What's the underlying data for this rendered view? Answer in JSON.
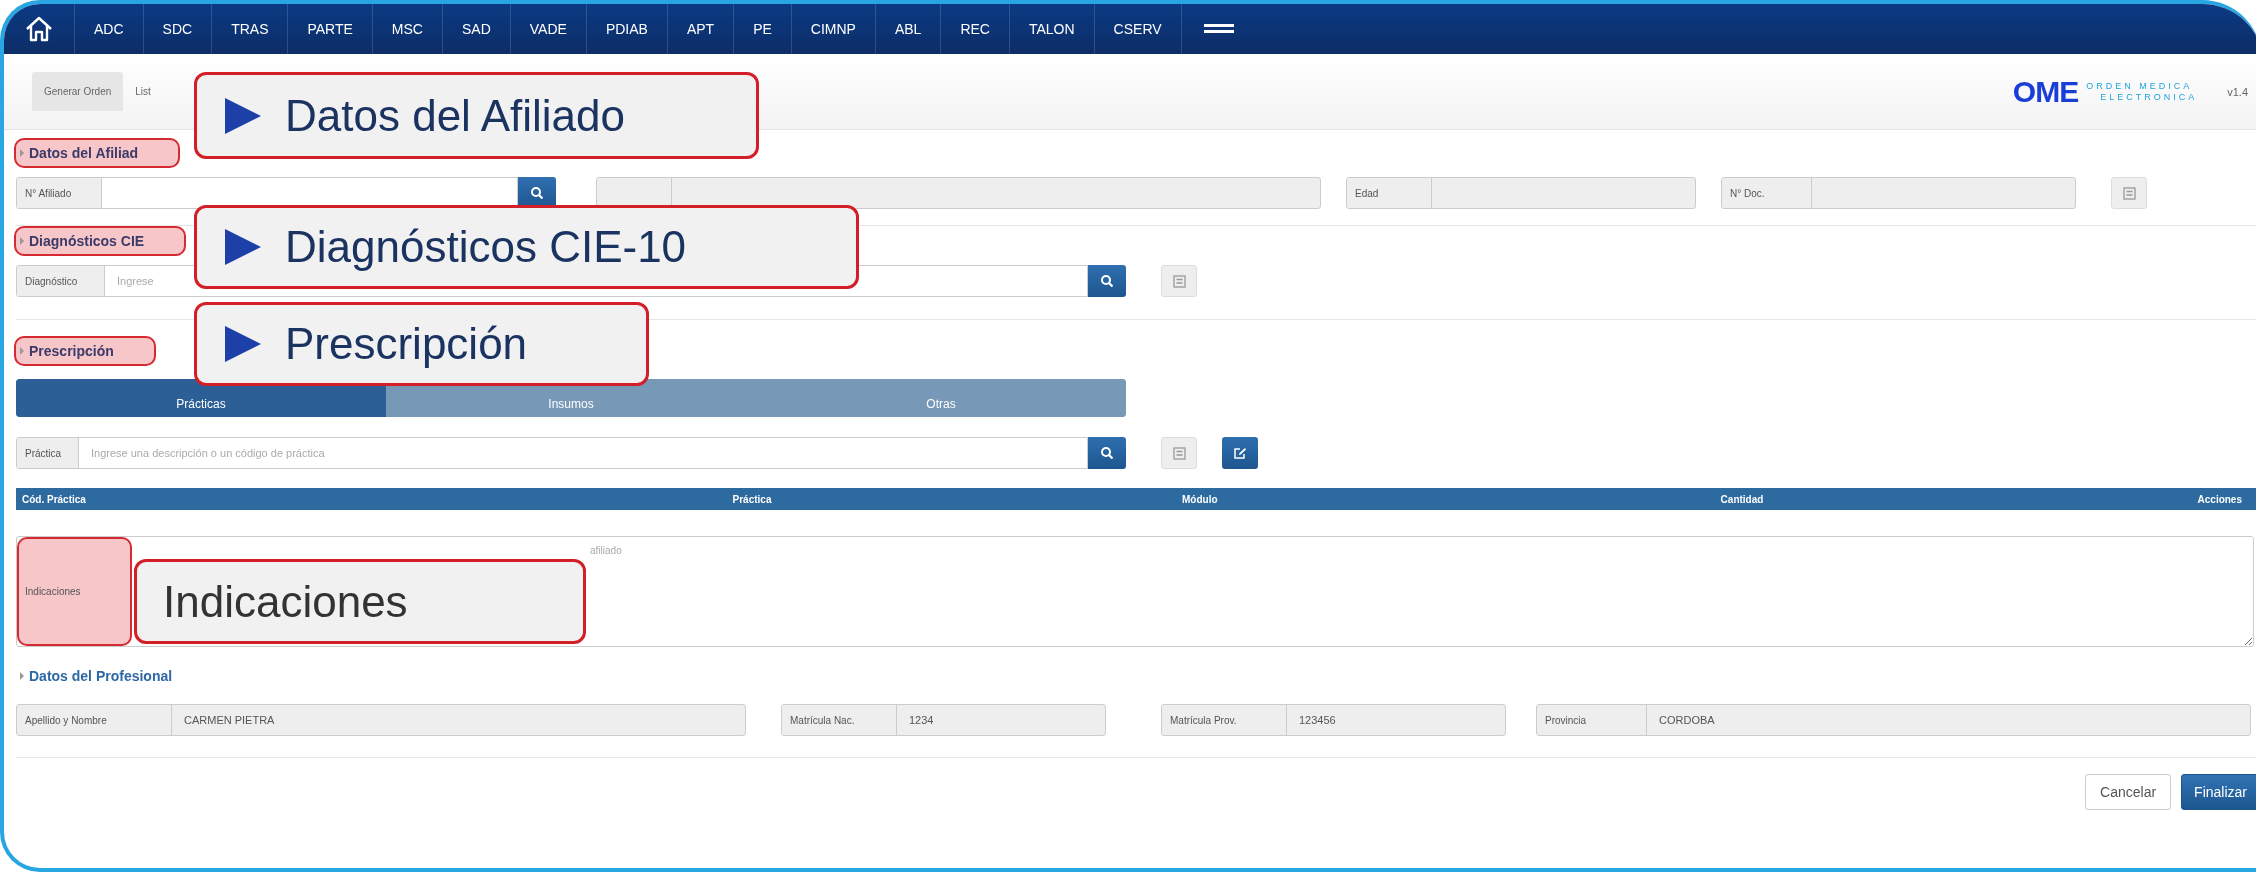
{
  "nav": {
    "items": [
      "ADC",
      "SDC",
      "TRAS",
      "PARTE",
      "MSC",
      "SAD",
      "VADE",
      "PDIAB",
      "APT",
      "PE",
      "CIMNP",
      "ABL",
      "REC",
      "TALON",
      "CSERV"
    ]
  },
  "subnav": {
    "tabs": [
      {
        "label": "Generar Orden",
        "selected": true
      },
      {
        "label": "List",
        "selected": false
      }
    ],
    "logo": {
      "mark": "OME",
      "line_1": "ORDEN MEDICA",
      "line_2": "ELECTRONICA"
    },
    "version": "v1.4"
  },
  "afiliado": {
    "title": "Datos del Afiliad",
    "highlighted": true,
    "fields": [
      {
        "label": "N° Afiliado",
        "kind": "search",
        "disabled": false
      },
      {
        "kind": "plain",
        "disabled": true
      },
      {
        "label": "Edad",
        "kind": "plain",
        "disabled": true
      },
      {
        "label": "N° Doc.",
        "kind": "plain",
        "disabled": true
      }
    ]
  },
  "diagnosticos": {
    "title": "Diagnósticos CIE",
    "highlighted": true,
    "field": {
      "label": "Diagnóstico",
      "placeholder": "Ingrese"
    }
  },
  "prescripcion": {
    "title": "Prescripción",
    "highlighted": true,
    "tabs": [
      {
        "label": "Prácticas",
        "selected": true
      },
      {
        "label": "Insumos",
        "selected": false
      },
      {
        "label": "Otras",
        "selected": false
      }
    ],
    "field": {
      "label": "Práctica",
      "placeholder": "Ingrese una descripción o un código de práctica"
    },
    "table": {
      "columns": [
        "Cód. Práctica",
        "Práctica",
        "Módulo",
        "Cantidad",
        "Acciones"
      ]
    },
    "indicaciones": {
      "label": "Indicaciones",
      "highlighted": true,
      "placeholder": "afiliado"
    }
  },
  "profesional": {
    "title": "Datos del Profesional",
    "highlighted": false,
    "fields": [
      {
        "label": "Apellido y Nombre",
        "value": "CARMEN PIETRA",
        "disabled": true
      },
      {
        "label": "Matrícula Nac.",
        "value": "1234",
        "disabled": true
      },
      {
        "label": "Matrícula Prov.",
        "value": "123456",
        "disabled": true
      },
      {
        "label": "Provincia",
        "value": "CORDOBA",
        "disabled": true
      }
    ]
  },
  "buttons": [
    {
      "label": "Cancelar",
      "kind": "default"
    },
    {
      "label": "Finalizar",
      "kind": "primary"
    }
  ],
  "callouts": [
    {
      "text": "Datos del Afiliado",
      "arrow": true
    },
    {
      "text": "Diagnósticos CIE-10",
      "arrow": true
    },
    {
      "text": "Prescripción",
      "arrow": true
    },
    {
      "text": "Indicaciones",
      "arrow": false
    }
  ]
}
